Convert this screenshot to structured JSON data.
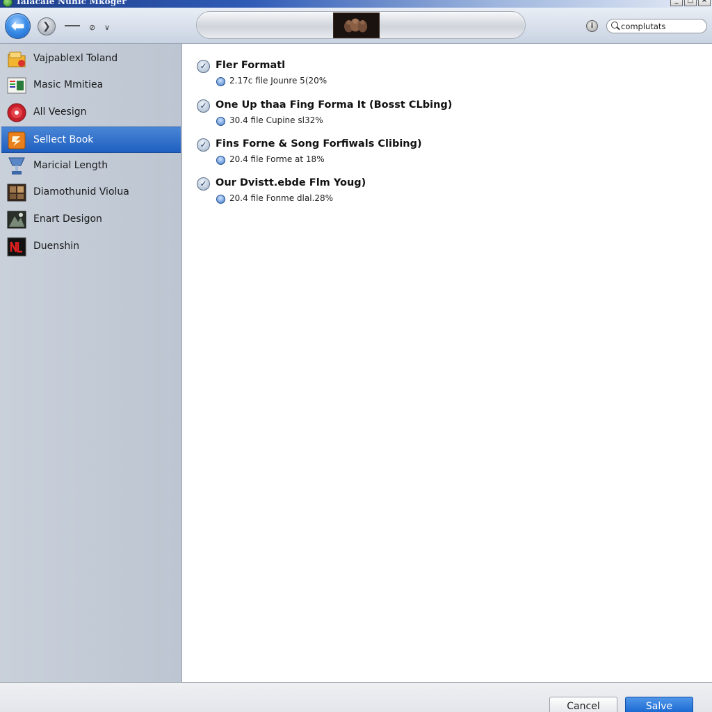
{
  "window": {
    "title": "Ialacale Nuhic Mkoger",
    "controls": [
      "_",
      "□",
      "×"
    ]
  },
  "toolbar": {
    "back_icon": "back-arrow-icon",
    "forward_icon": "forward-arrow-icon",
    "dash_glyph": "—",
    "dot_glyph": "⊘",
    "chevron_glyph": "∨",
    "info_glyph": "i",
    "search": {
      "value": "complutats",
      "icon": "search-icon"
    }
  },
  "sidebar": {
    "items": [
      {
        "label": "Vajpablexl Toland",
        "icon": "folder-icon",
        "selected": false
      },
      {
        "label": "Masic Mmitiea",
        "icon": "document-icon",
        "selected": false
      },
      {
        "label": "All Veesign",
        "icon": "record-icon",
        "selected": false
      },
      {
        "label": "Sellect Book",
        "icon": "book-icon",
        "selected": true
      },
      {
        "label": "Maricial Length",
        "icon": "trophy-icon",
        "selected": false
      },
      {
        "label": "Diamothunid Violua",
        "icon": "photo-icon",
        "selected": false
      },
      {
        "label": "Enart Desigon",
        "icon": "image-icon",
        "selected": false
      },
      {
        "label": "Duenshin",
        "icon": "nl-logo-icon",
        "selected": false
      }
    ]
  },
  "main": {
    "entries": [
      {
        "title": "Fler Formatl",
        "meta": "2.17c file Jounre 5(20%"
      },
      {
        "title": "One Up thaa Fing Forma It (Bosst CLbing)",
        "meta": "30.4 file Cupine sl32%"
      },
      {
        "title": "Fins Forne & Song Forfiwals Clibing)",
        "meta": "20.4 file Forme at 18%"
      },
      {
        "title": "Our Dvistt.ebde Flm Youg)",
        "meta": "20.4 file Fonme dlal.28%"
      }
    ]
  },
  "footer": {
    "cancel_label": "Cancel",
    "save_label": "Salve"
  },
  "colors": {
    "selection": "#2f6fcc",
    "sidebar_bg": "#c4ccd7",
    "save_button": "#1565cf"
  }
}
